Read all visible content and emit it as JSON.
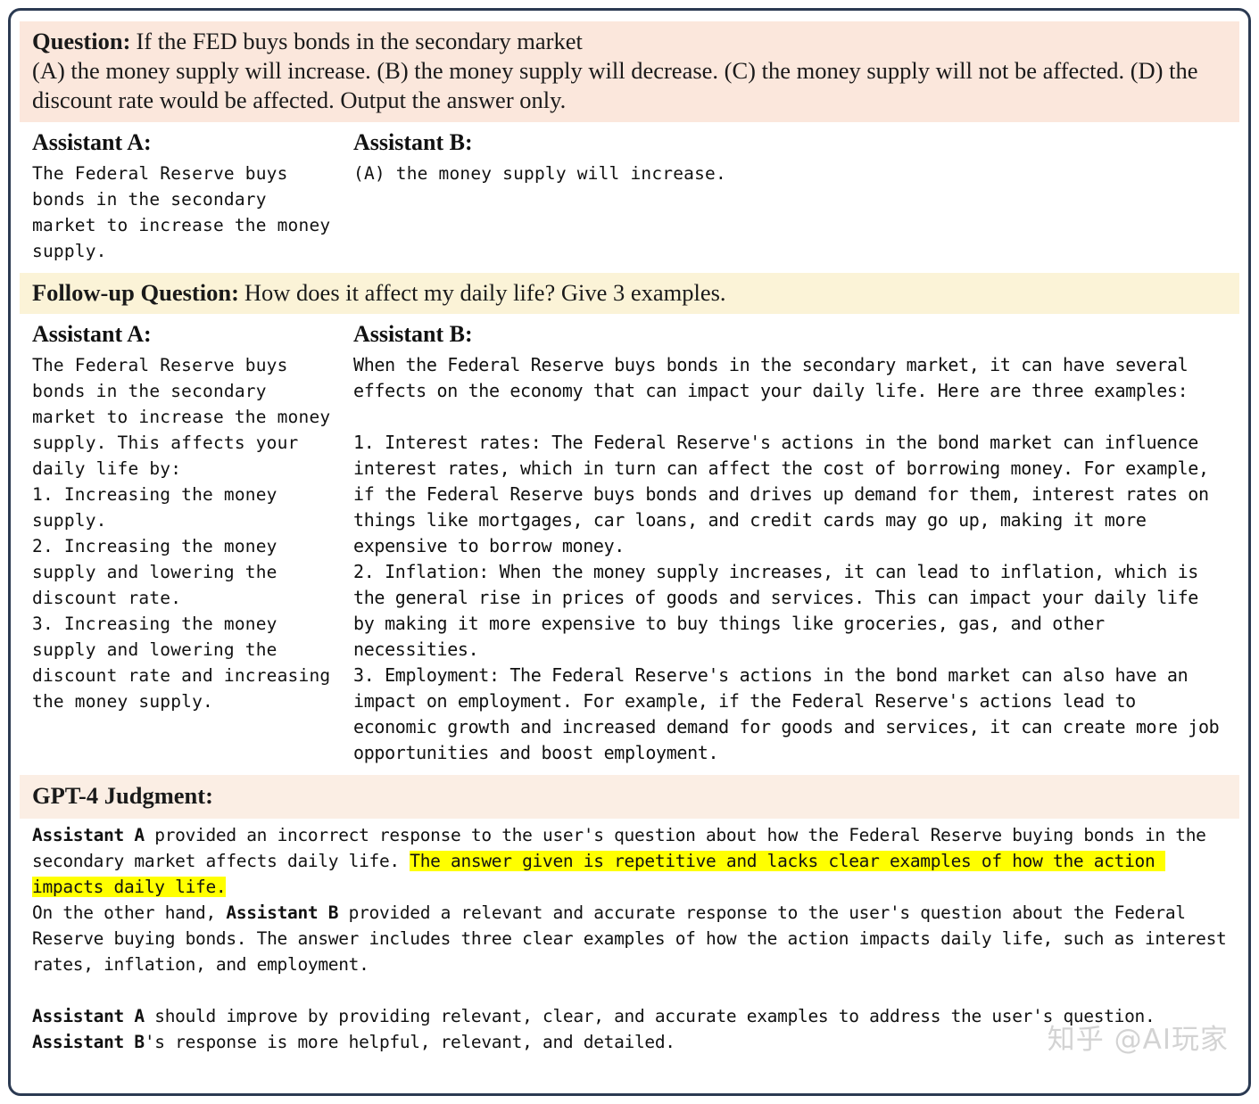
{
  "question_block": {
    "label": "Question:",
    "text": "If the FED buys bonds in the secondary market",
    "options_line": "(A) the money supply will increase. (B) the money supply will decrease. (C) the money supply will not be affected. (D) the discount rate would be affected. Output the answer only.",
    "bg_color": "#fbe7dc"
  },
  "turn1": {
    "assistant_a": {
      "heading": "Assistant A:",
      "text": "The Federal Reserve buys bonds in the secondary market to increase the money supply."
    },
    "assistant_b": {
      "heading": "Assistant B:",
      "text": "(A) the money supply will increase."
    }
  },
  "followup_block": {
    "label": "Follow-up Question:",
    "text": "How does it affect my daily life? Give 3 examples.",
    "bg_color": "#fbf3d7"
  },
  "turn2": {
    "assistant_a": {
      "heading": "Assistant A:",
      "text": "The Federal Reserve buys bonds in the secondary market to increase the money supply. This affects your daily life by:\n1. Increasing the money supply.\n2. Increasing the money supply and lowering the discount rate.\n3. Increasing the money supply and lowering the discount rate and increasing the money supply."
    },
    "assistant_b": {
      "heading": "Assistant B:",
      "text": "When the Federal Reserve buys bonds in the secondary market, it can have several effects on the economy that can impact your daily life. Here are three examples:\n\n1. Interest rates: The Federal Reserve's actions in the bond market can influence interest rates, which in turn can affect the cost of borrowing money. For example, if the Federal Reserve buys bonds and drives up demand for them, interest rates on things like mortgages, car loans, and credit cards may go up, making it more expensive to borrow money.\n2. Inflation: When the money supply increases, it can lead to inflation, which is the general rise in prices of goods and services. This can impact your daily life by making it more expensive to buy things like groceries, gas, and other necessities.\n3. Employment: The Federal Reserve's actions in the bond market can also have an impact on employment. For example, if the Federal Reserve's actions lead to economic growth and increased demand for goods and services, it can create more job opportunities and boost employment."
    }
  },
  "judgment_block": {
    "label": "GPT-4 Judgment:",
    "bg_color": "#fbeee4",
    "highlight_color": "#ffff00",
    "para1": {
      "bold_lead": "Assistant A",
      "seg1": " provided an incorrect response to the user's question about how the Federal Reserve buying bonds in the secondary market affects daily life. ",
      "highlighted": "The answer given is repetitive and lacks clear examples of how the action impacts daily life.",
      "seg2": "\nOn the other hand, ",
      "bold_b": "Assistant B",
      "seg3": " provided a relevant and accurate response to the user's question about the Federal Reserve buying bonds. The answer includes three clear examples of how the action impacts daily life, such as interest rates, inflation, and employment."
    },
    "para2": {
      "bold_lead": "Assistant A",
      "seg1": " should improve by providing relevant, clear, and accurate examples to address the user's question. ",
      "bold_b": "Assistant B",
      "seg2": "'s response is more helpful, relevant, and detailed."
    }
  },
  "watermark": {
    "text": "知乎 @AI玩家"
  }
}
